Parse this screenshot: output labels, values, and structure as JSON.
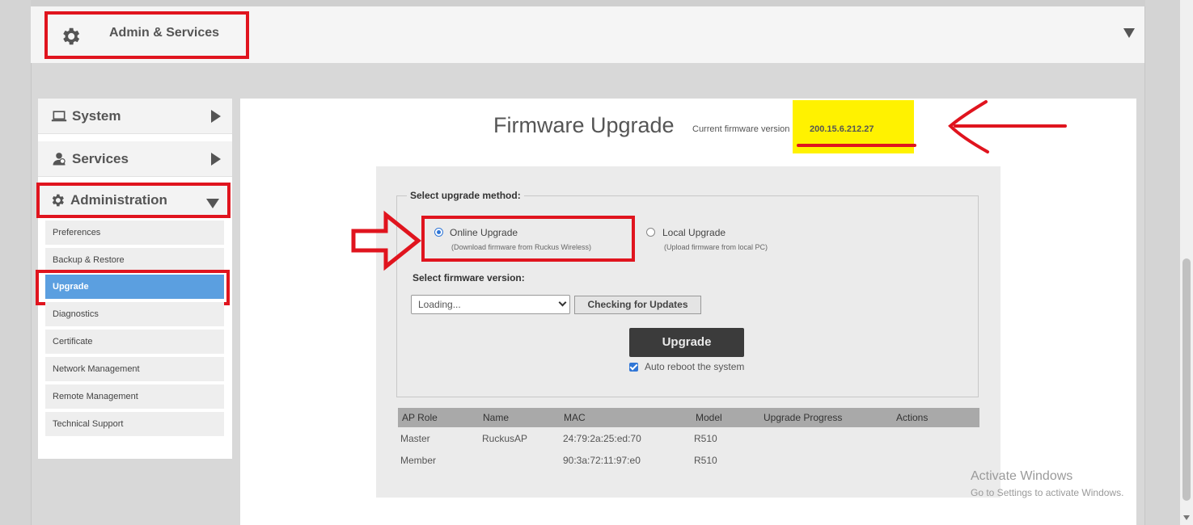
{
  "header": {
    "title": "Admin & Services"
  },
  "sidebar": {
    "main_items": [
      {
        "label": "System"
      },
      {
        "label": "Services"
      },
      {
        "label": "Administration"
      }
    ],
    "sub_items": [
      {
        "label": "Preferences"
      },
      {
        "label": "Backup & Restore"
      },
      {
        "label": "Upgrade"
      },
      {
        "label": "Diagnostics"
      },
      {
        "label": "Certificate"
      },
      {
        "label": "Network Management"
      },
      {
        "label": "Remote Management"
      },
      {
        "label": "Technical Support"
      }
    ],
    "active_sub_item": "Upgrade"
  },
  "main": {
    "title": "Firmware Upgrade",
    "current_version_label": "Current firmware version",
    "current_version": "200.15.6.212.27",
    "method_legend": "Select upgrade method:",
    "online": {
      "label": "Online Upgrade",
      "sub": "(Download firmware from Ruckus Wireless)",
      "selected": true
    },
    "local": {
      "label": "Local Upgrade",
      "sub": "(Upload firmware from local PC)",
      "selected": false
    },
    "select_label": "Select firmware version:",
    "select_value": "Loading...",
    "check_button": "Checking for Updates",
    "upgrade_button": "Upgrade",
    "auto_reboot_label": "Auto reboot the system",
    "auto_reboot_checked": true,
    "table": {
      "headers": [
        "AP Role",
        "Name",
        "MAC",
        "Model",
        "Upgrade Progress",
        "Actions"
      ],
      "rows": [
        [
          "Master",
          "RuckusAP",
          "24:79:2a:25:ed:70",
          "R510",
          "",
          ""
        ],
        [
          "Member",
          "",
          "90:3a:72:11:97:e0",
          "R510",
          "",
          ""
        ]
      ]
    }
  },
  "watermark": {
    "line1": "Activate Windows",
    "line2": "Go to Settings to activate Windows."
  },
  "colors": {
    "annotation_red": "#e0141e",
    "highlight_yellow": "#fff200",
    "active_blue": "#5b9fe0"
  }
}
